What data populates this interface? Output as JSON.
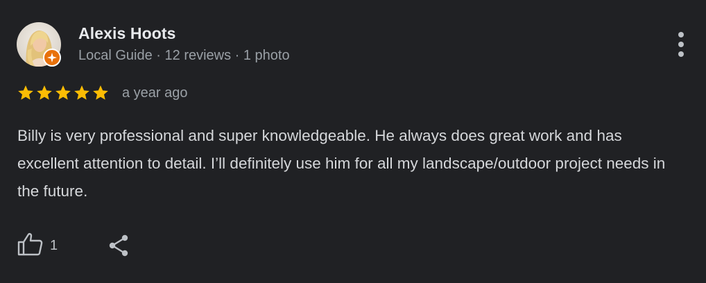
{
  "review": {
    "reviewer": {
      "name": "Alexis Hoots",
      "meta": "Local Guide · 12 reviews · 1 photo",
      "badge_icon": "local-guide-badge-icon",
      "badge_color": "#e8710a"
    },
    "rating": 5,
    "rating_max": 5,
    "star_color": "#fbbc04",
    "time": "a year ago",
    "text": "Billy is very professional and super knowledgeable. He always does great work and has excellent attention to detail. I’ll definitely use him for all my landscape/outdoor project needs in the future.",
    "actions": {
      "like_icon": "thumbs-up-icon",
      "like_count": "1",
      "share_icon": "share-icon",
      "more_icon": "more-vert-icon"
    }
  },
  "colors": {
    "background": "#202124",
    "primary_text": "#e8eaed",
    "secondary_text": "#9aa0a6"
  }
}
